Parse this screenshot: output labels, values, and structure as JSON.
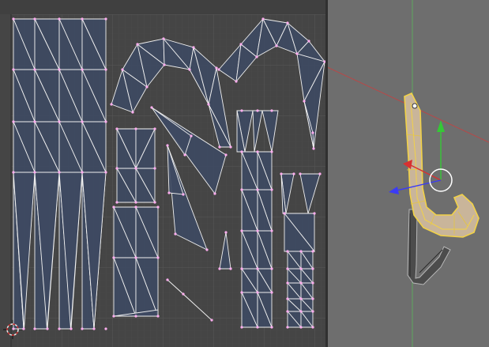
{
  "editor": {
    "name": "uv-image-editor",
    "background_color": "#454545",
    "grid_color": "#4f4f4f",
    "island_fill_color": "#3e4a62",
    "edge_color": "#f0f0f0",
    "vertex_color": "#ffaef0",
    "cursor_icon": "2d-cursor-icon"
  },
  "viewport": {
    "name": "3d-viewport",
    "background_color": "#6e6e6e",
    "object": "hook-mesh",
    "selection_color": "#f5d04a",
    "axis_colors": {
      "x": "#d83030",
      "y": "#35c835",
      "z": "#3b3bf5"
    },
    "manipulator": "translate-manipulator-icon"
  }
}
